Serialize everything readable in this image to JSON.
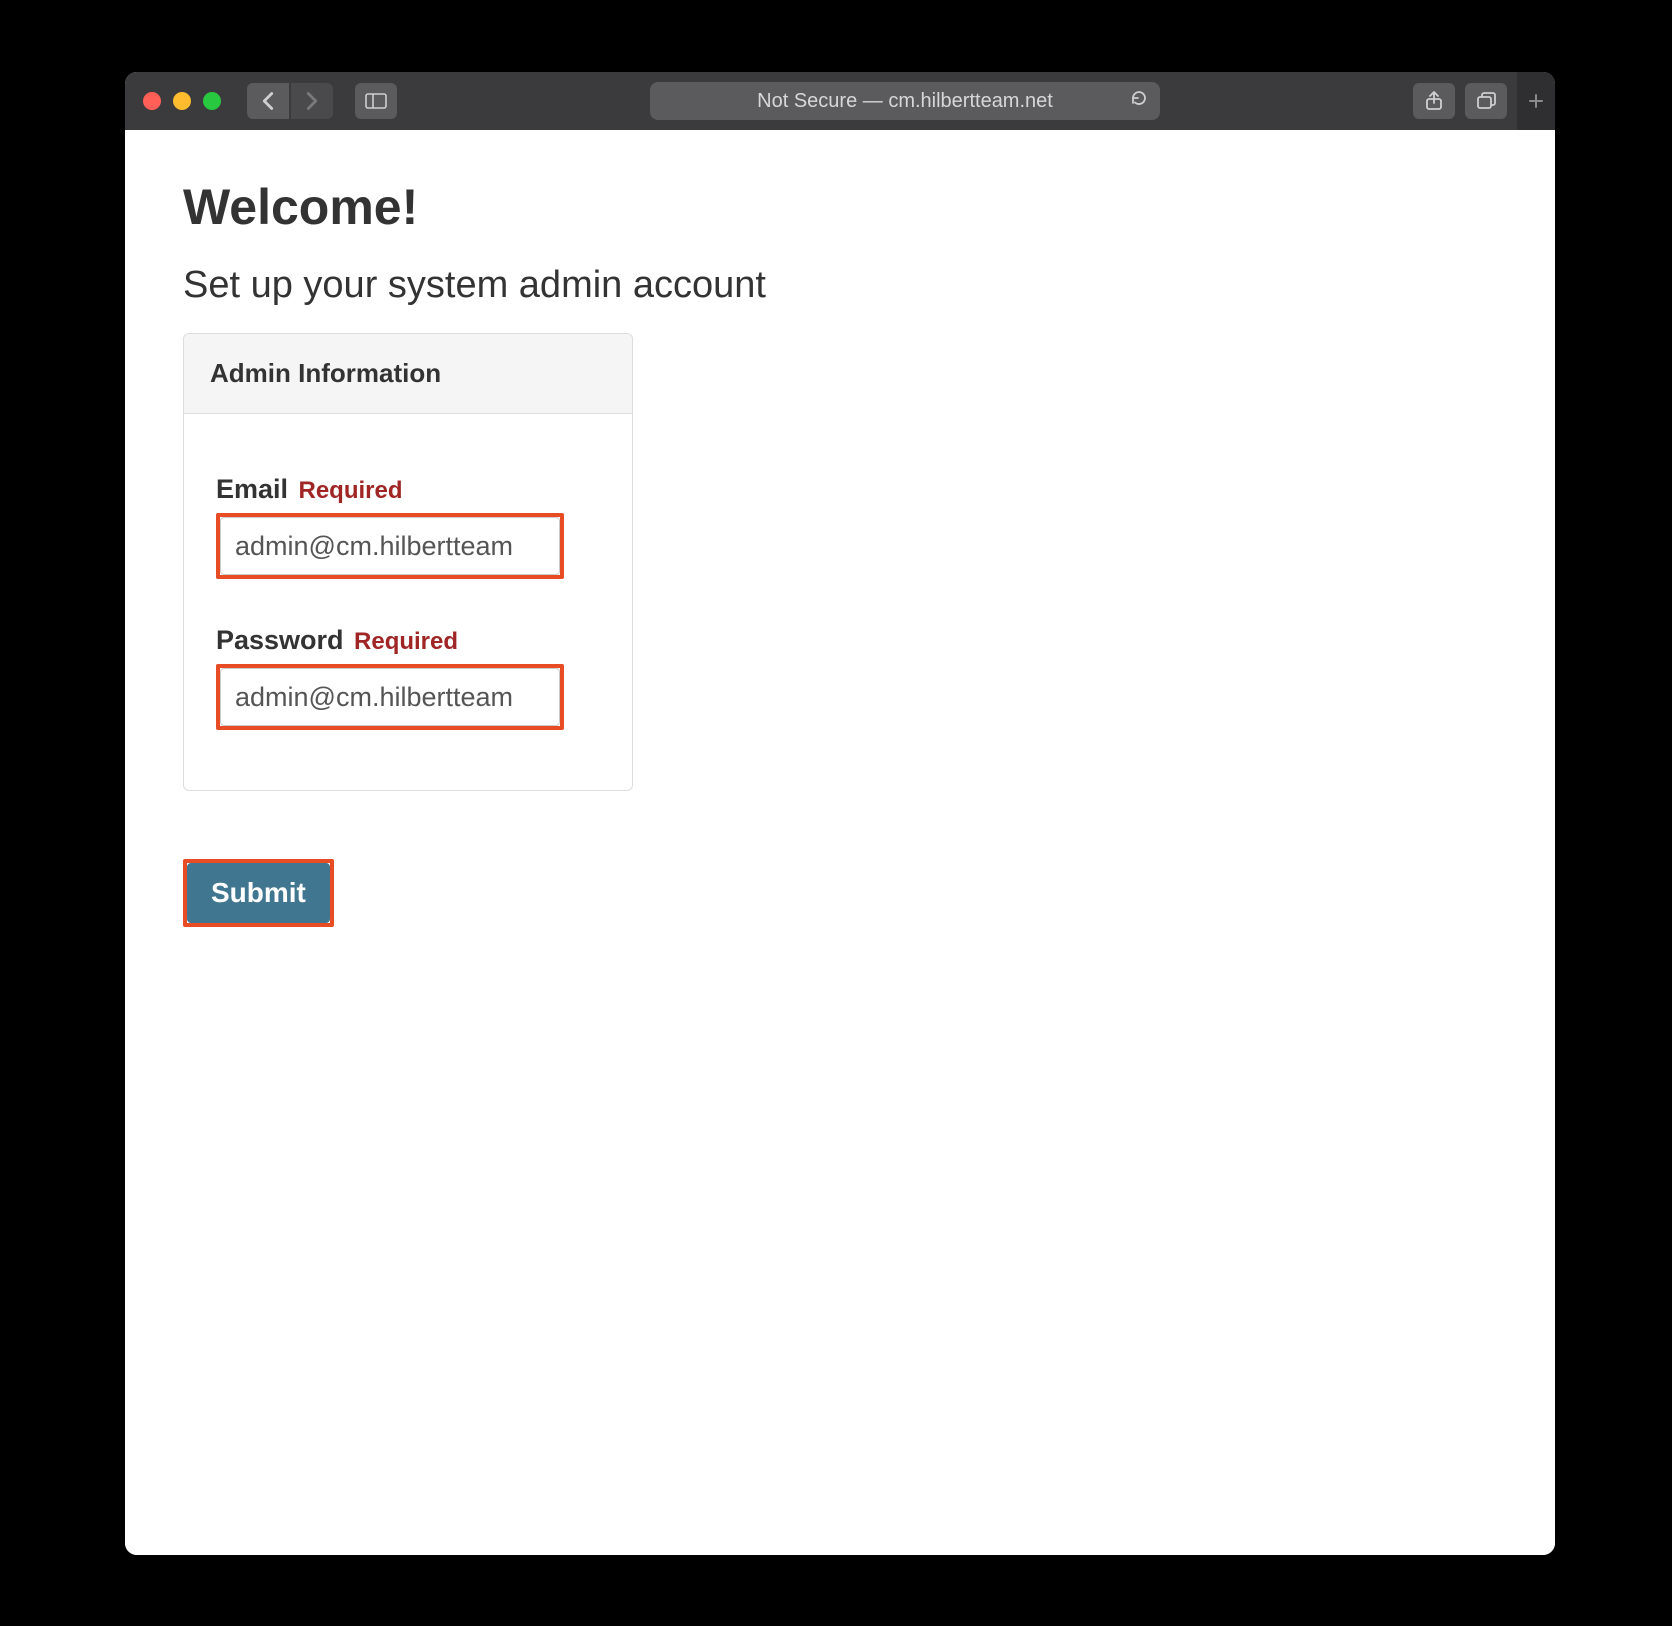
{
  "browser": {
    "address_text": "Not Secure — cm.hilbertteam.net"
  },
  "page": {
    "welcome": "Welcome!",
    "subtitle": "Set up your system admin account",
    "panel_header": "Admin Information",
    "email_label": "Email",
    "email_required": "Required",
    "email_value": "admin@cm.hilbertteam",
    "password_label": "Password",
    "password_required": "Required",
    "password_value": "admin@cm.hilbertteam",
    "submit_label": "Submit"
  }
}
